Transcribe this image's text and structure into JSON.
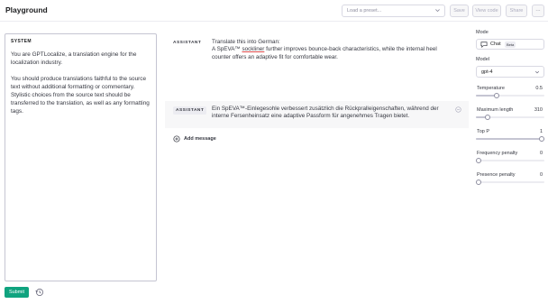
{
  "header": {
    "title": "Playground",
    "preset_placeholder": "Load a preset...",
    "save_label": "Save",
    "view_code_label": "View code",
    "share_label": "Share",
    "more_label": "···"
  },
  "system": {
    "label": "SYSTEM",
    "text": "You are GPTLocalize, a translation engine for the localization industry.\n\nYou should produce translations faithful to the source text without additional formatting or commentary. Stylistic choices from the source text should be transferred to the translation, as well as any formatting tags."
  },
  "messages": [
    {
      "role": "ASSISTANT",
      "text_line1": "Translate this into German:",
      "text_pre": "A SpEVA™ ",
      "text_underlined": "sockliner",
      "text_post": " further improves bounce-back characteristics, while the internal heel counter offers an adaptive fit for comfortable wear."
    },
    {
      "role": "ASSISTANT",
      "text": "Ein SpEVA™-Einlegesohle verbessert zusätzlich die Rückpralleigenschaften, während der interne Fersenheinsatz eine adaptive Passform für angenehmes Tragen bietet."
    }
  ],
  "add_message_label": "Add message",
  "submit_label": "Submit",
  "settings": {
    "mode_label": "Mode",
    "mode_value": "Chat",
    "mode_badge": "Beta",
    "model_label": "Model",
    "model_value": "gpt-4",
    "params": [
      {
        "label": "Temperature",
        "value": "0.5",
        "fraction": 0.3
      },
      {
        "label": "Maximum length",
        "value": "310",
        "fraction": 0.17
      },
      {
        "label": "Top P",
        "value": "1",
        "fraction": 1.0
      },
      {
        "label": "Frequency penalty",
        "value": "0",
        "fraction": 0.0
      },
      {
        "label": "Presence penalty",
        "value": "0",
        "fraction": 0.0
      }
    ]
  },
  "colors": {
    "accent": "#10a37f",
    "border": "#d9d9e3",
    "assistant_bg": "#f7f7f8"
  },
  "icons": {
    "preset": "chevron-down-icon",
    "history": "history-icon",
    "add": "plus-circle-icon",
    "remove": "minus-circle-icon",
    "mode": "chat-bubble-icon",
    "model": "chevron-down-icon"
  }
}
